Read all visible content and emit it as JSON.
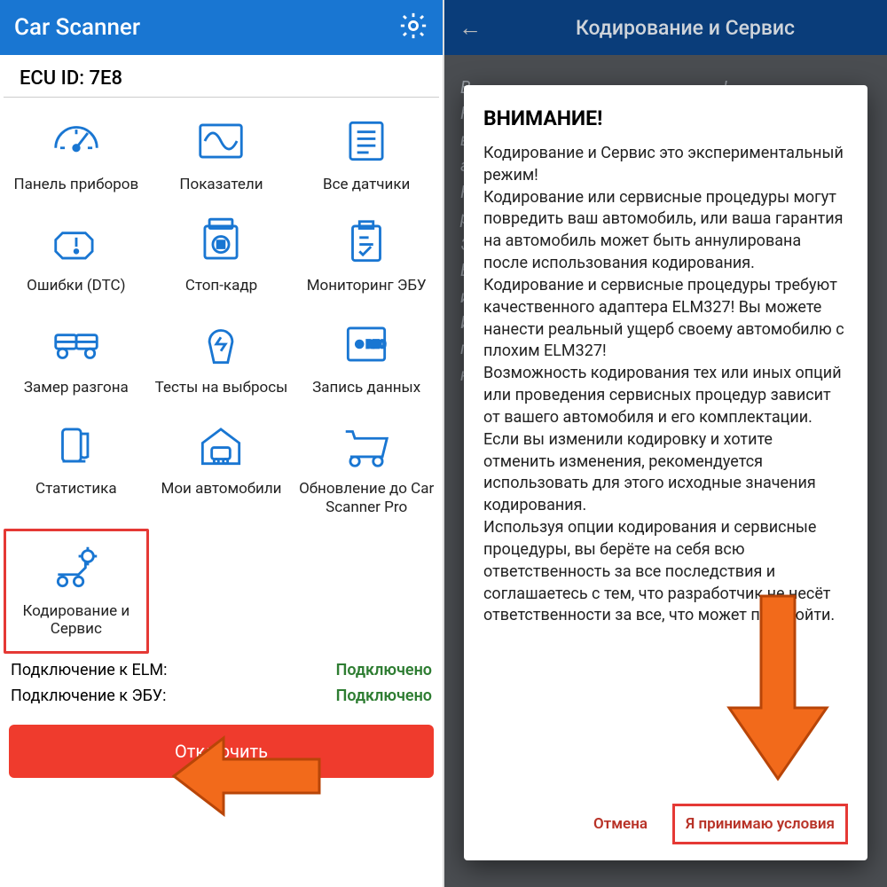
{
  "left": {
    "app_title": "Car Scanner",
    "ecu_label": "ECU ID: 7E8",
    "tiles": [
      {
        "id": "dashboard",
        "label": "Панель приборов"
      },
      {
        "id": "indicators",
        "label": "Показатели"
      },
      {
        "id": "allsensors",
        "label": "Все датчики"
      },
      {
        "id": "dtc",
        "label": "Ошибки (DTC)"
      },
      {
        "id": "freeze",
        "label": "Стоп-кадр"
      },
      {
        "id": "ecumon",
        "label": "Мониторинг ЭБУ"
      },
      {
        "id": "accel",
        "label": "Замер разгона"
      },
      {
        "id": "emissions",
        "label": "Тесты на выбросы"
      },
      {
        "id": "record",
        "label": "Запись данных"
      },
      {
        "id": "stats",
        "label": "Статистика"
      },
      {
        "id": "mycars",
        "label": "Мои автомобили"
      },
      {
        "id": "upgrade",
        "label": "Обновление до Car Scanner Pro"
      },
      {
        "id": "coding",
        "label": "Кодирование и Сервис"
      }
    ],
    "status": {
      "elm_label": "Подключение к ELM:",
      "elm_value": "Подключено",
      "ecu_label": "Подключение к ЭБУ:",
      "ecu_value": "Подключено"
    },
    "disconnect": "Отключить"
  },
  "right": {
    "header": "Кодирование и Сервис",
    "dialog": {
      "title": "ВНИМАНИЕ!",
      "body": "Кодирование и Сервис это экспериментальный режим!\nКодирование или сервисные процедуры могут повредить ваш автомобиль, или ваша гарантия на автомобиль может быть аннулирована после использования кодирования.\nКодирование и сервисные процедуры требуют качественного адаптера ELM327! Вы можете нанести реальный ущерб своему автомобилю с плохим ELM327!\nВозможность кодирования тех или иных опций или проведения сервисных процедур зависит от вашего автомобиля и его комплектации.\nЕсли вы изменили кодировку и хотите отменить изменения, рекомендуется использовать для этого исходные значения кодирования.\nИспользуя опции кодирования и сервисные процедуры, вы берёте на себя всю ответственность за все последствия и соглашаетесь с тем, что разработчик не несёт ответственности за все, что может произойти.",
      "cancel": "Отмена",
      "accept": "Я принимаю условия"
    }
  }
}
